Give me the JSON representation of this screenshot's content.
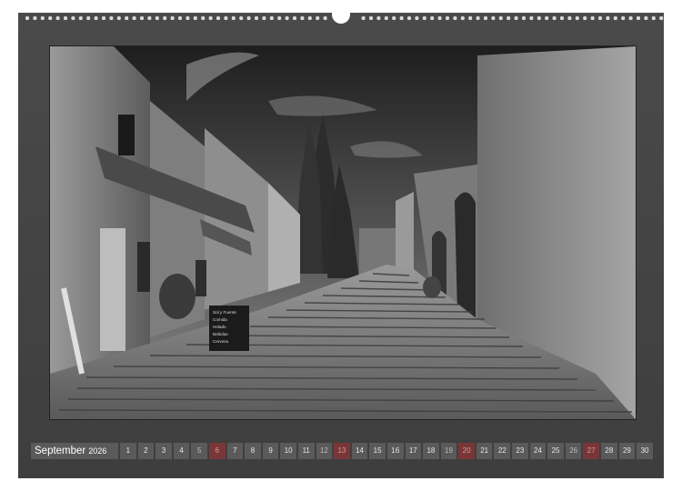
{
  "calendar": {
    "month": "September",
    "year": "2026",
    "days": [
      {
        "n": "1",
        "t": "wd"
      },
      {
        "n": "2",
        "t": "wd"
      },
      {
        "n": "3",
        "t": "wd"
      },
      {
        "n": "4",
        "t": "wd"
      },
      {
        "n": "5",
        "t": "sat"
      },
      {
        "n": "6",
        "t": "sun"
      },
      {
        "n": "7",
        "t": "wd"
      },
      {
        "n": "8",
        "t": "wd"
      },
      {
        "n": "9",
        "t": "wd"
      },
      {
        "n": "10",
        "t": "wd"
      },
      {
        "n": "11",
        "t": "wd"
      },
      {
        "n": "12",
        "t": "sat"
      },
      {
        "n": "13",
        "t": "sun"
      },
      {
        "n": "14",
        "t": "wd"
      },
      {
        "n": "15",
        "t": "wd"
      },
      {
        "n": "16",
        "t": "wd"
      },
      {
        "n": "17",
        "t": "wd"
      },
      {
        "n": "18",
        "t": "wd"
      },
      {
        "n": "19",
        "t": "sat"
      },
      {
        "n": "20",
        "t": "sun"
      },
      {
        "n": "21",
        "t": "wd"
      },
      {
        "n": "22",
        "t": "wd"
      },
      {
        "n": "23",
        "t": "wd"
      },
      {
        "n": "24",
        "t": "wd"
      },
      {
        "n": "25",
        "t": "wd"
      },
      {
        "n": "26",
        "t": "sat"
      },
      {
        "n": "27",
        "t": "sun"
      },
      {
        "n": "28",
        "t": "wd"
      },
      {
        "n": "29",
        "t": "wd"
      },
      {
        "n": "30",
        "t": "wd"
      }
    ]
  },
  "photo": {
    "chalkboard_lines": [
      "Sol y Fuente",
      "Comida",
      "Helado",
      "Bebidas",
      "Cerveza"
    ]
  },
  "colors": {
    "page": "#444444",
    "cell": "#5a5a5a",
    "sunday": "#7a3636"
  }
}
